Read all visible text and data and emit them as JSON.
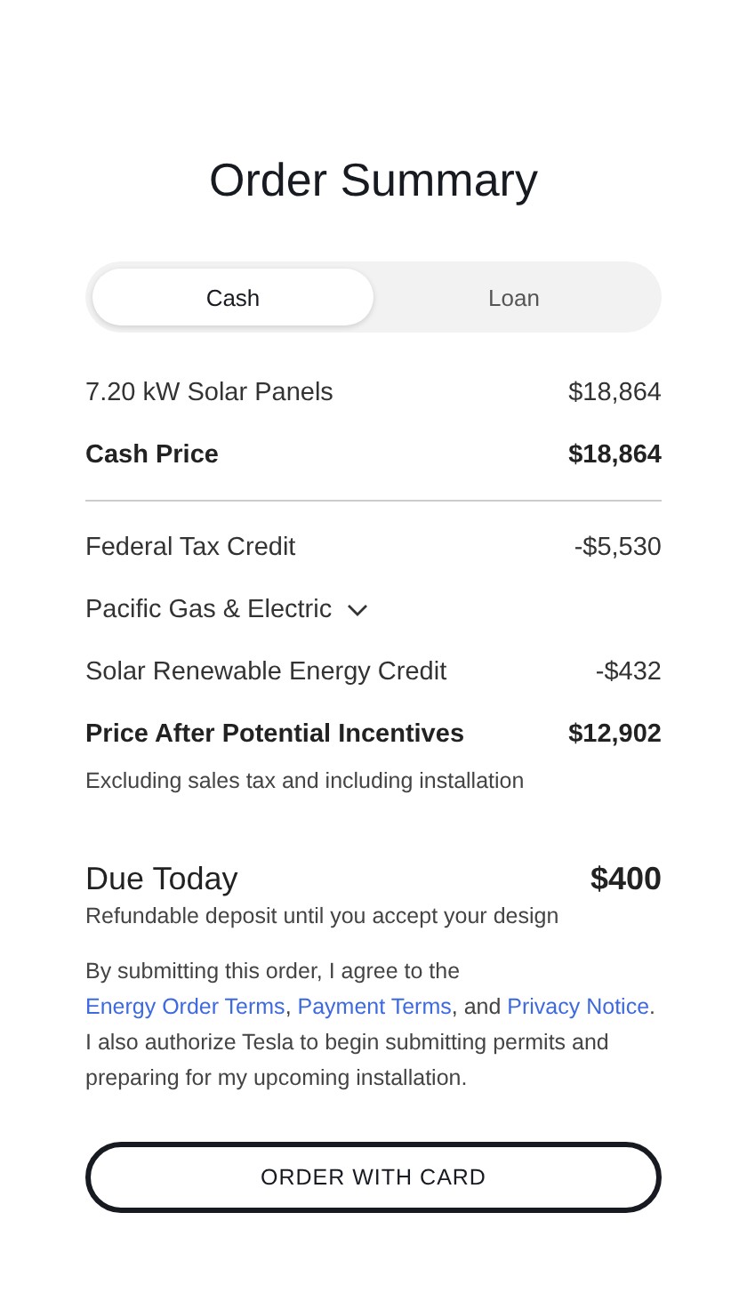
{
  "title": "Order Summary",
  "tabs": [
    {
      "label": "Cash",
      "selected": true
    },
    {
      "label": "Loan",
      "selected": false
    }
  ],
  "price_lines": [
    {
      "kind": "item",
      "label": "7.20 kW Solar Panels",
      "value": "$18,864"
    },
    {
      "kind": "total",
      "label": "Cash Price",
      "value": "$18,864"
    }
  ],
  "incentive_lines": [
    {
      "kind": "item",
      "label": "Federal Tax Credit",
      "value": "-$5,530"
    },
    {
      "kind": "dropdown",
      "label": "Pacific Gas & Electric",
      "expanded": false
    },
    {
      "kind": "item",
      "label": "Solar Renewable Energy Credit",
      "value": "-$432"
    },
    {
      "kind": "total",
      "label": "Price After Potential Incentives",
      "value": "$12,902"
    }
  ],
  "incentives_note": "Excluding sales tax and including installation",
  "due_today": {
    "label": "Due Today",
    "value": "$400",
    "note": "Refundable deposit until you accept your design"
  },
  "agreement": [
    {
      "kind": "text",
      "text": "By submitting this order, I agree to the "
    },
    {
      "kind": "link",
      "text": "Energy Order Terms"
    },
    {
      "kind": "text",
      "text": ", "
    },
    {
      "kind": "link",
      "text": "Payment Terms"
    },
    {
      "kind": "text",
      "text": ", and "
    },
    {
      "kind": "link",
      "text": "Privacy Notice"
    },
    {
      "kind": "text",
      "text": ". I also authorize Tesla to begin submitting permits and preparing for my upcoming installation."
    }
  ],
  "order_button": "ORDER WITH CARD"
}
